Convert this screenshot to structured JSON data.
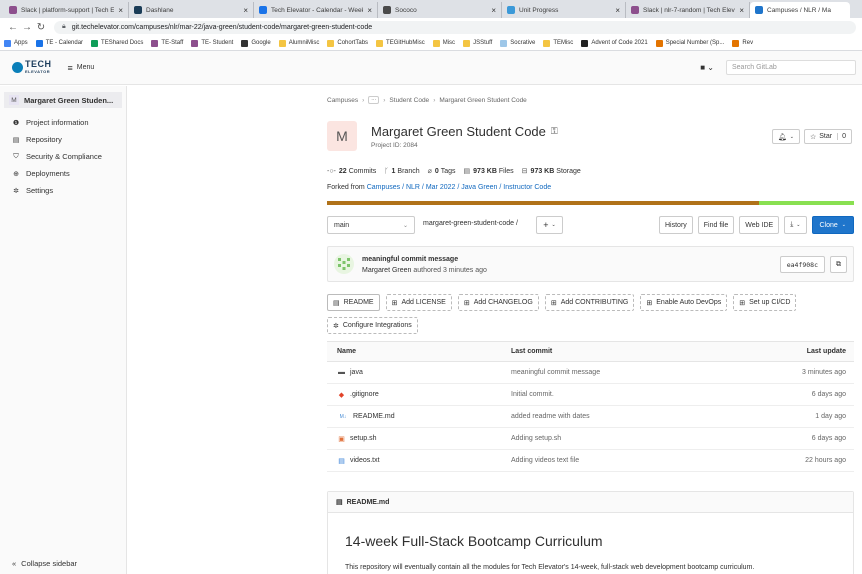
{
  "browser": {
    "tabs": [
      {
        "label": "Slack | platform-support | Tech E",
        "close": "×",
        "fav": "#8d4f8d",
        "w": 125
      },
      {
        "label": "Dashlane",
        "close": "×",
        "fav": "#1a3c57",
        "w": 125
      },
      {
        "label": "Tech Elevator - Calendar - Week",
        "close": "×",
        "fav": "#1a73e8",
        "w": 124
      },
      {
        "label": "Sococo",
        "close": "×",
        "fav": "#4a4a4a",
        "w": 124
      },
      {
        "label": "Unit Progress",
        "close": "×",
        "fav": "#3b99d8",
        "w": 124
      },
      {
        "label": "Slack | nlr-7-random | Tech Elev",
        "close": "×",
        "fav": "#8d4f8d",
        "w": 124
      },
      {
        "label": "Campuses / NLR / Ma",
        "close": "",
        "fav": "#1f75cb",
        "w": 100,
        "active": true
      }
    ],
    "url": "git.techelevator.com/campuses/nlr/mar-22/java-green/student-code/margaret-green-student-code",
    "bookmarks": [
      {
        "label": "Apps",
        "color": "#4285f4"
      },
      {
        "label": "TE - Calendar",
        "color": "#1a73e8"
      },
      {
        "label": "TEShared Docs",
        "color": "#0f9d58"
      },
      {
        "label": "TE-Staff",
        "color": "#8d4f8d"
      },
      {
        "label": "TE- Student",
        "color": "#8d4f8d"
      },
      {
        "label": "Google",
        "color": "#333"
      },
      {
        "label": "AlumniMisc",
        "color": "#f4c542"
      },
      {
        "label": "CohortTabs",
        "color": "#f4c542"
      },
      {
        "label": "TEGitHubMisc",
        "color": "#f4c542"
      },
      {
        "label": "Misc",
        "color": "#f4c542"
      },
      {
        "label": "JSStuff",
        "color": "#f4c542"
      },
      {
        "label": "Socrative",
        "color": "#9ec7e8"
      },
      {
        "label": "TEMisc",
        "color": "#f4c542"
      },
      {
        "label": "Advent of Code 2021",
        "color": "#222"
      },
      {
        "label": "Special Number (Sp...",
        "color": "#e37400"
      },
      {
        "label": "Rev",
        "color": "#e37400"
      }
    ]
  },
  "header": {
    "logo_text": "TECH",
    "logo_sub": "ELEVATOR",
    "menu_label": "Menu",
    "search_placeholder": "Search GitLab"
  },
  "sidebar": {
    "project_avatar": "M",
    "project_name": "Margaret Green Studen...",
    "items": [
      {
        "label": "Project information",
        "icon": "info-icon",
        "glyph": "❶"
      },
      {
        "label": "Repository",
        "icon": "document-icon",
        "glyph": "▤"
      },
      {
        "label": "Security & Compliance",
        "icon": "shield-icon",
        "glyph": "⛉"
      },
      {
        "label": "Deployments",
        "icon": "rocket-icon",
        "glyph": "⊕"
      },
      {
        "label": "Settings",
        "icon": "gear-icon",
        "glyph": "✲"
      }
    ],
    "collapse_label": "Collapse sidebar"
  },
  "breadcrumb": {
    "items": [
      "Campuses",
      "···",
      "Student Code",
      "Margaret Green Student Code"
    ]
  },
  "project": {
    "avatar": "M",
    "name": "Margaret Green Student Code",
    "id_label": "Project ID: 2084",
    "star_label": "Star",
    "star_count": "0",
    "stats": {
      "commits_n": "22",
      "commits_l": "Commits",
      "branch_n": "1",
      "branch_l": "Branch",
      "tags_n": "0",
      "tags_l": "Tags",
      "files_n": "973 KB",
      "files_l": "Files",
      "storage_n": "973 KB",
      "storage_l": "Storage"
    },
    "forked_prefix": "Forked from",
    "forked_link": "Campuses / NLR / Mar 2022 / Java Green / Instructor Code",
    "lang_colors": [
      "#b07219",
      "#89e051"
    ]
  },
  "toolbar": {
    "branch": "main",
    "path": "margaret-green-student-code /",
    "history": "History",
    "find_file": "Find file",
    "web_ide": "Web IDE",
    "clone": "Clone"
  },
  "commit": {
    "message": "meaningful commit message",
    "author": "Margaret Green",
    "meta": "authored 3 minutes ago",
    "sha": "ea4f908c"
  },
  "actions": {
    "row1": [
      {
        "label": "README",
        "glyph": "▤",
        "solid": true
      },
      {
        "label": "Add LICENSE",
        "glyph": "⊞"
      },
      {
        "label": "Add CHANGELOG",
        "glyph": "⊞"
      },
      {
        "label": "Add CONTRIBUTING",
        "glyph": "⊞"
      },
      {
        "label": "Enable Auto DevOps",
        "glyph": "⊞"
      },
      {
        "label": "Set up CI/CD",
        "glyph": "⊞"
      }
    ],
    "row2": [
      {
        "label": "Configure Integrations",
        "glyph": "✲"
      }
    ]
  },
  "files": {
    "headers": {
      "name": "Name",
      "commit": "Last commit",
      "update": "Last update"
    },
    "rows": [
      {
        "name": "java",
        "icon": "folder-icon",
        "glyph": "▬",
        "color": "#555",
        "commit": "meaningful commit message",
        "update": "3 minutes ago"
      },
      {
        "name": ".gitignore",
        "icon": "git-icon",
        "glyph": "◆",
        "color": "#e24329",
        "commit": "Initial commit.",
        "update": "6 days ago"
      },
      {
        "name": "README.md",
        "icon": "markdown-icon",
        "glyph": "M↓",
        "color": "#4a8ed6",
        "commit": "added readme with dates",
        "update": "1 day ago"
      },
      {
        "name": "setup.sh",
        "icon": "shell-icon",
        "glyph": "▣",
        "color": "#e0703a",
        "commit": "Adding setup.sh",
        "update": "6 days ago"
      },
      {
        "name": "videos.txt",
        "icon": "text-file-icon",
        "glyph": "▤",
        "color": "#2e7bd6",
        "commit": "Adding videos text file",
        "update": "22 hours ago"
      }
    ]
  },
  "readme": {
    "file": "README.md",
    "title": "14-week Full-Stack Bootcamp Curriculum",
    "text": "This repository will eventually contain all the modules for Tech Elevator's 14-week, full-stack web development bootcamp curriculum."
  }
}
